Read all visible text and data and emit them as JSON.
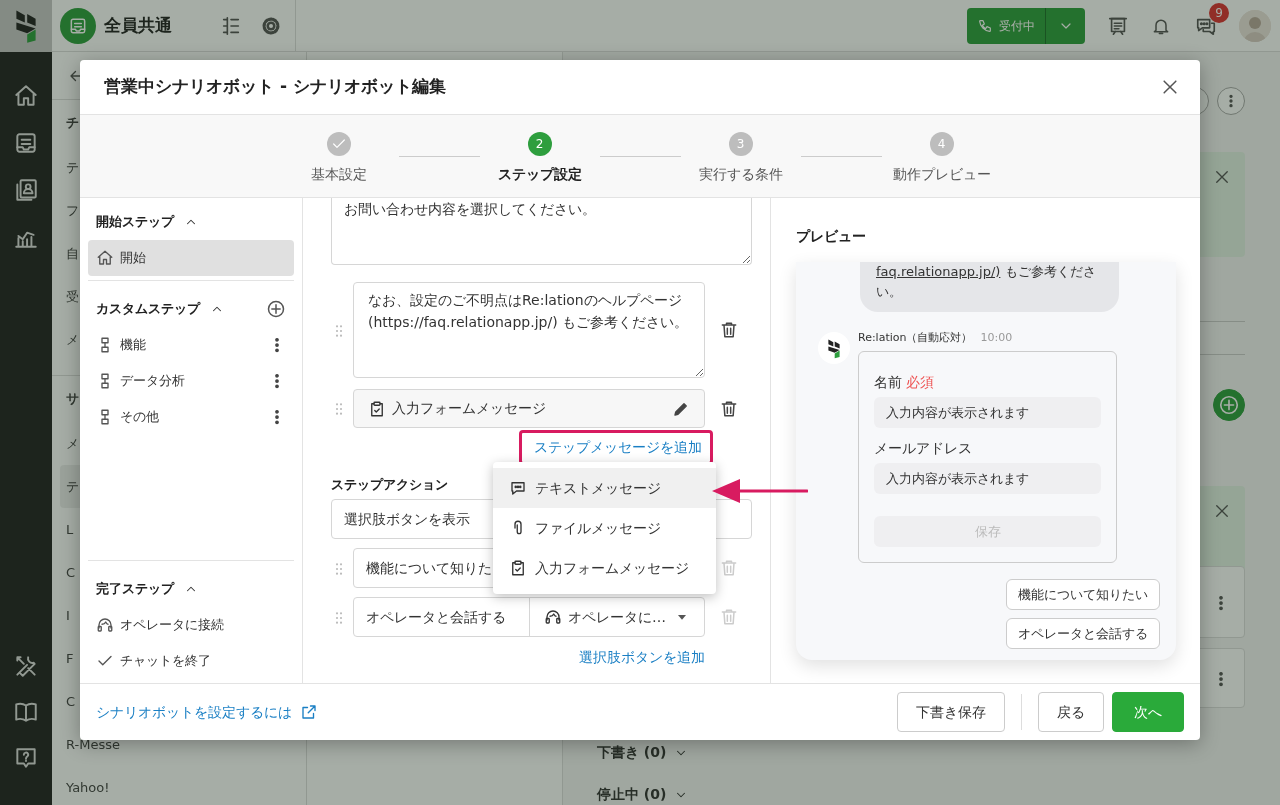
{
  "app": {
    "workspace": "全員共通",
    "status_button": "受付中",
    "chat_badge": "9"
  },
  "background": {
    "list_items": [
      {
        "text": "チ",
        "kind": "header",
        "selected": false
      },
      {
        "text": "テ",
        "kind": "item",
        "selected": false
      },
      {
        "text": "フ",
        "kind": "item",
        "selected": false
      },
      {
        "text": "自",
        "kind": "item",
        "selected": false
      },
      {
        "text": "受",
        "kind": "item",
        "selected": false
      },
      {
        "text": "メ",
        "kind": "item",
        "selected": false
      },
      {
        "text": "サ",
        "kind": "header",
        "selected": false
      },
      {
        "text": "メ",
        "kind": "item",
        "selected": false
      },
      {
        "text": "テ",
        "kind": "item",
        "selected": true
      },
      {
        "text": "L",
        "kind": "item",
        "selected": false
      },
      {
        "text": "C",
        "kind": "item",
        "selected": false
      },
      {
        "text": "I",
        "kind": "item",
        "selected": false
      },
      {
        "text": "F",
        "kind": "item",
        "selected": false
      },
      {
        "text": "C",
        "kind": "item",
        "selected": false
      },
      {
        "text": "R-Messe",
        "kind": "item",
        "selected": false
      },
      {
        "text": "Yahoo!",
        "kind": "item",
        "selected": false
      }
    ],
    "sections": [
      "下書き (0)",
      "停止中 (0)"
    ]
  },
  "dialog": {
    "title": "営業中シナリオボット - シナリオボット編集",
    "steps": [
      {
        "label": "基本設定",
        "completed": true,
        "selected": false
      },
      {
        "number": "2",
        "label": "ステップ設定",
        "completed": false,
        "selected": true
      },
      {
        "number": "3",
        "label": "実行する条件",
        "completed": false,
        "selected": false
      },
      {
        "number": "4",
        "label": "動作プレビュー",
        "completed": false,
        "selected": false
      }
    ]
  },
  "sidebar": {
    "sections": [
      {
        "title": "開始ステップ",
        "expanded": true,
        "addable": false,
        "items": [
          {
            "label": "開始",
            "kind": "start",
            "selected": true
          }
        ]
      },
      {
        "title": "カスタムステップ",
        "expanded": true,
        "addable": true,
        "items": [
          {
            "label": "機能",
            "kind": "step",
            "selected": false
          },
          {
            "label": "データ分析",
            "kind": "step",
            "selected": false
          },
          {
            "label": "その他",
            "kind": "step",
            "selected": false
          }
        ]
      },
      {
        "title": "完了ステップ",
        "expanded": true,
        "addable": false,
        "items": [
          {
            "label": "オペレータに接続",
            "kind": "operator",
            "selected": false
          },
          {
            "label": "チャットを終了",
            "kind": "end",
            "selected": false
          }
        ]
      }
    ]
  },
  "editor": {
    "top_message": "お問い合わせ内容を選択してください。",
    "messages": [
      {
        "kind": "text",
        "text": "なお、設定のご不明点はRe:lationのヘルプページ(https://faq.relationapp.jp/) もご参考ください。"
      },
      {
        "kind": "form",
        "text": "入力フォームメッセージ"
      }
    ],
    "add_message_link": "ステップメッセージを追加",
    "action_label": "ステップアクション",
    "action_select": "選択肢ボタンを表示",
    "choices": [
      {
        "label": "機能について知りた",
        "delete_disabled": true
      },
      {
        "label": "オペレータと会話する",
        "target": "オペレータに…",
        "delete_disabled": true
      }
    ],
    "add_choice_link": "選択肢ボタンを追加"
  },
  "menu": {
    "items": [
      {
        "kind": "text",
        "label": "テキストメッセージ",
        "selected": true
      },
      {
        "kind": "file",
        "label": "ファイルメッセージ",
        "selected": false
      },
      {
        "kind": "form",
        "label": "入力フォームメッセージ",
        "selected": false
      }
    ]
  },
  "preview": {
    "title": "プレビュー",
    "bubble": {
      "link": "faq.relationapp.jp/)",
      "text": " もご参考ください。"
    },
    "sender": "Re:lation（自動応対）",
    "time": "10:00",
    "form": {
      "fields": [
        {
          "label": "名前",
          "required_label": "必須",
          "placeholder": "入力内容が表示されます"
        },
        {
          "label": "メールアドレス",
          "placeholder": "入力内容が表示されます"
        }
      ],
      "submit": "保存"
    },
    "choices": [
      "機能について知りたい",
      "オペレータと会話する"
    ]
  },
  "footer": {
    "help_link": "シナリオボットを設定するには",
    "buttons": [
      {
        "label": "下書き保存",
        "kind": "secondary"
      },
      {
        "label": "戻る",
        "kind": "secondary"
      },
      {
        "label": "次へ",
        "kind": "primary"
      }
    ]
  }
}
